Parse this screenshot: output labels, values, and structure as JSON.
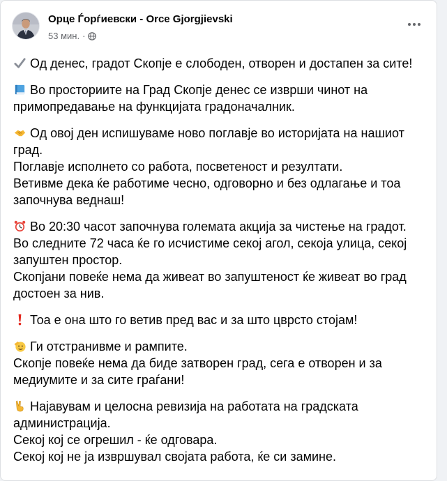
{
  "post": {
    "author": "Орце Ѓорѓиевски - Orce Gjorgjievski",
    "time": "53 мин.",
    "separator": "·",
    "privacy_icon": "globe-icon",
    "more_icon": "more-options-icon"
  },
  "paragraphs": [
    {
      "emoji": "check-mark-icon",
      "lines": [
        "Од денес, градот Скопје е слободен, отворен и достапен за сите!"
      ]
    },
    {
      "emoji": "blue-book-icon",
      "lines": [
        "Во просториите на Град Скопје денес се изврши чинот на",
        "примопредавање на функцијата градоначалник."
      ]
    },
    {
      "emoji": "handshake-icon",
      "lines": [
        "Од овој ден испишуваме ново поглавје во историјата на нашиот",
        "град.",
        "Поглавје исполнето со работа, посветеност и резултати.",
        "Ветивме дека ќе работиме чесно, одговорно и без одлагање и тоа",
        "започнува веднаш!"
      ]
    },
    {
      "emoji": "alarm-clock-icon",
      "lines": [
        "Во 20:30 часот започнува големата акција за чистење на градот.",
        "Во следните 72 часа ќе го исчистиме секој агол, секоја улица, секој",
        "запуштен простор.",
        "Скопјани повеќе нема да живеат во запуштеност ќе живеат во град",
        "достоен за нив."
      ]
    },
    {
      "emoji": "exclamation-icon",
      "lines": [
        "Тоа е она што го ветив пред вас и за што цврсто стојам!"
      ]
    },
    {
      "emoji": "saluting-face-icon",
      "lines": [
        "Ги отстранивме и рампите.",
        "Скопје повеќе нема да биде затворен град, сега е отворен и за",
        "медиумите и за сите граѓани!"
      ]
    },
    {
      "emoji": "victory-hand-icon",
      "lines": [
        "Најавувам и целосна ревизија на работата на градската",
        "администрација.",
        "Секој кој се огрешил - ќе одговара.",
        "Секој кој не ја извршувал својата работа, ќе си замине."
      ]
    }
  ]
}
